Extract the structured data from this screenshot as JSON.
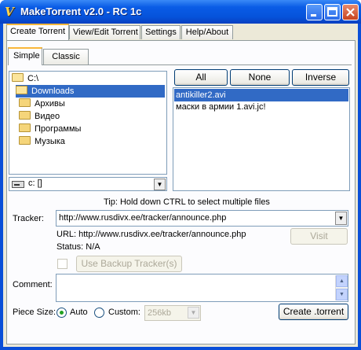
{
  "window": {
    "title": "MakeTorrent v2.0 - RC 1c"
  },
  "tabs": [
    {
      "label": "Create Torrent"
    },
    {
      "label": "View/Edit Torrent"
    },
    {
      "label": "Settings"
    },
    {
      "label": "Help/About"
    }
  ],
  "subtabs": [
    {
      "label": "Simple"
    },
    {
      "label": "Classic"
    }
  ],
  "tree": {
    "items": [
      {
        "label": "C:\\"
      },
      {
        "label": "Downloads"
      },
      {
        "label": "Архивы"
      },
      {
        "label": "Видео"
      },
      {
        "label": "Программы"
      },
      {
        "label": "Музыка"
      }
    ]
  },
  "drive": {
    "value": "c: []"
  },
  "selection_buttons": {
    "all": "All",
    "none": "None",
    "inverse": "Inverse"
  },
  "files": [
    {
      "label": "antikiller2.avi"
    },
    {
      "label": "маски в армии 1.avi.jc!"
    }
  ],
  "tip": "Tip: Hold down CTRL to select multiple files",
  "tracker": {
    "label": "Tracker:",
    "value": "http://www.rusdivx.ee/tracker/announce.php",
    "url_text": "URL: http://www.rusdivx.ee/tracker/announce.php",
    "status_text": "Status: N/A",
    "visit_label": "Visit",
    "backup_label": "Use Backup Tracker(s)"
  },
  "comment": {
    "label": "Comment:",
    "value": ""
  },
  "piece": {
    "label": "Piece Size:",
    "auto_label": "Auto",
    "custom_label": "Custom:",
    "custom_value": "256kb"
  },
  "create_label": "Create .torrent"
}
